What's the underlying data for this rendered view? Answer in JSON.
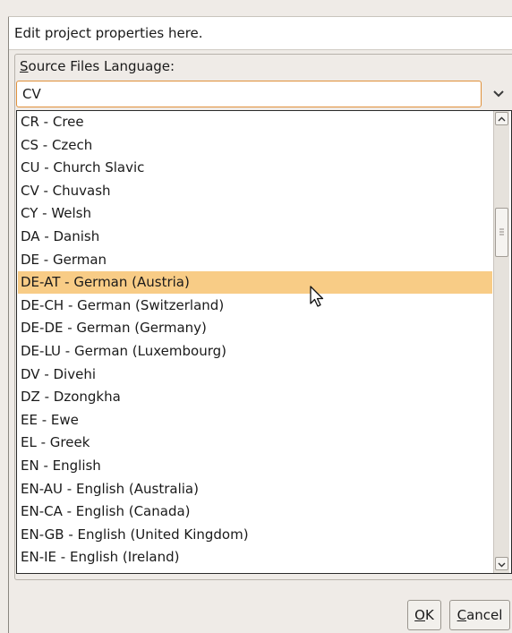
{
  "header": {
    "description": "Edit project properties here."
  },
  "field": {
    "label_mnemonic": "S",
    "label_rest": "ource Files Language:",
    "value": "CV"
  },
  "list": {
    "selected_index": 7,
    "items": [
      "CR - Cree",
      "CS - Czech",
      "CU - Church Slavic",
      "CV - Chuvash",
      "CY - Welsh",
      "DA - Danish",
      "DE - German",
      "DE-AT - German (Austria)",
      "DE-CH - German (Switzerland)",
      "DE-DE - German (Germany)",
      "DE-LU - German (Luxembourg)",
      "DV - Divehi",
      "DZ - Dzongkha",
      "EE - Ewe",
      "EL - Greek",
      "EN - English",
      "EN-AU - English (Australia)",
      "EN-CA - English (Canada)",
      "EN-GB - English (United Kingdom)",
      "EN-IE - English (Ireland)"
    ]
  },
  "buttons": {
    "ok_mnemonic": "O",
    "ok_rest": "K",
    "cancel_mnemonic": "C",
    "cancel_rest": "ancel"
  },
  "colors": {
    "selection": "#f8cc86",
    "focus_border": "#e0903a"
  },
  "icons": {
    "combo_arrow": "chevron-down-icon",
    "scroll_up": "triangle-up-icon",
    "scroll_down": "triangle-down-icon",
    "cursor": "mouse-pointer-icon"
  }
}
